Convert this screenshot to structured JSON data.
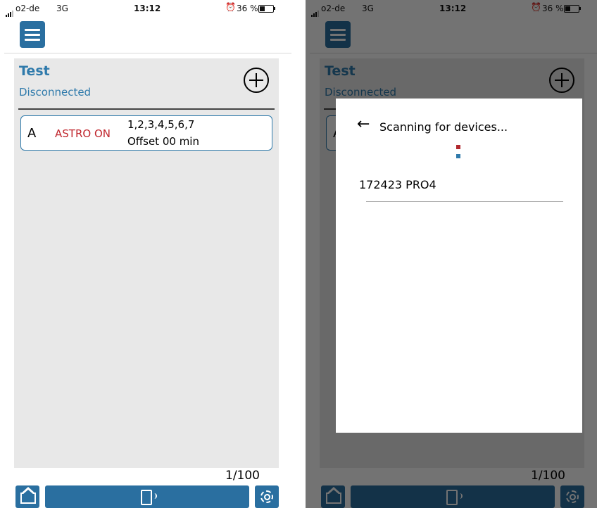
{
  "status_bar": {
    "carrier": "o2-de",
    "network": "3G",
    "time": "13:12",
    "battery": "36 %",
    "battery_level": 0.36
  },
  "screen": {
    "device_name": "Test",
    "connection_status": "Disconnected",
    "programs": [
      {
        "channel": "A",
        "mode": "ASTRO ON",
        "days": "1,2,3,4,5,6,7",
        "offset": "Offset 00 min"
      }
    ],
    "counter": "1/100"
  },
  "dialog": {
    "title": "Scanning for devices...",
    "devices": [
      "172423 PRO4"
    ]
  },
  "colors": {
    "accent": "#2a6fa0",
    "title": "#2f7aab",
    "astro": "#c0262d",
    "spinner_red": "#b1282e",
    "spinner_blue": "#2f7aab"
  },
  "icons": [
    "menu-icon",
    "plus-icon",
    "home-icon",
    "phone-connect-icon",
    "settings-icon",
    "back-arrow-icon"
  ]
}
